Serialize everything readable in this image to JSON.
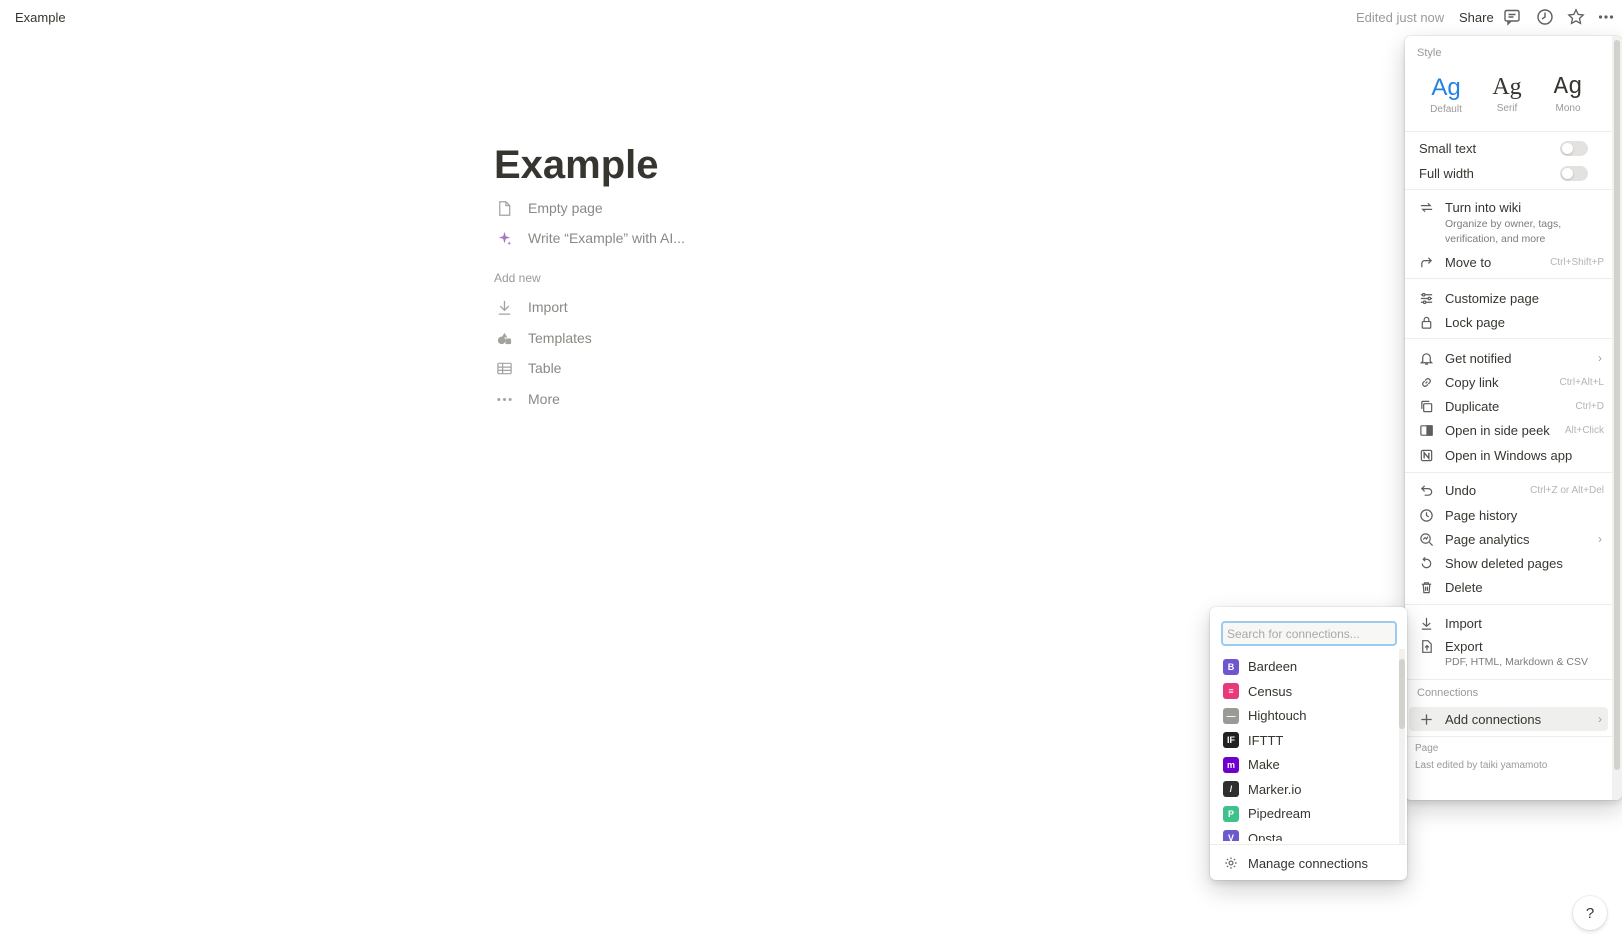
{
  "topbar": {
    "breadcrumb": "Example",
    "edited": "Edited just now",
    "share": "Share",
    "icons": [
      "comment-icon",
      "clock-icon",
      "star-icon",
      "more-icon"
    ]
  },
  "page": {
    "title": "Example",
    "options": [
      {
        "label": "Empty page",
        "icon": "page-icon"
      },
      {
        "label": "Write “Example” with AI...",
        "icon": "sparkle-icon"
      }
    ],
    "add_new_label": "Add new",
    "add_new": [
      {
        "label": "Import",
        "icon": "download-icon"
      },
      {
        "label": "Templates",
        "icon": "templates-icon"
      },
      {
        "label": "Table",
        "icon": "table-icon"
      },
      {
        "label": "More",
        "icon": "dots-icon"
      }
    ]
  },
  "menu": {
    "style_label": "Style",
    "styles": [
      {
        "sample": "Ag",
        "label": "Default",
        "active": true
      },
      {
        "sample": "Ag",
        "label": "Serif",
        "active": false
      },
      {
        "sample": "Ag",
        "label": "Mono",
        "active": false
      }
    ],
    "toggles": [
      {
        "label": "Small text",
        "on": false
      },
      {
        "label": "Full width",
        "on": false
      }
    ],
    "turn_into_wiki": {
      "label": "Turn into wiki",
      "sub": "Organize by owner, tags, verification, and more"
    },
    "move_to": {
      "label": "Move to",
      "shortcut": "Ctrl+Shift+P"
    },
    "customize": {
      "label": "Customize page"
    },
    "lock": {
      "label": "Lock page"
    },
    "get_notified": {
      "label": "Get notified"
    },
    "copy_link": {
      "label": "Copy link",
      "shortcut": "Ctrl+Alt+L"
    },
    "duplicate": {
      "label": "Duplicate",
      "shortcut": "Ctrl+D"
    },
    "side_peek": {
      "label": "Open in side peek",
      "shortcut": "Alt+Click"
    },
    "windows_app": {
      "label": "Open in Windows app"
    },
    "undo": {
      "label": "Undo",
      "shortcut": "Ctrl+Z or Alt+Del"
    },
    "page_history": {
      "label": "Page history"
    },
    "page_analytics": {
      "label": "Page analytics"
    },
    "show_deleted": {
      "label": "Show deleted pages"
    },
    "delete": {
      "label": "Delete"
    },
    "import": {
      "label": "Import"
    },
    "export": {
      "label": "Export",
      "sub": "PDF, HTML, Markdown & CSV"
    },
    "connections_label": "Connections",
    "add_connections": {
      "label": "Add connections"
    },
    "footer": {
      "line1": "Page",
      "line2": "Last edited by taiki yamamoto"
    }
  },
  "connections": {
    "search_placeholder": "Search for connections...",
    "items": [
      {
        "name": "Bardeen",
        "color": "#6e56cf",
        "glyph": "B"
      },
      {
        "name": "Census",
        "color": "#e8397a",
        "glyph": "≡"
      },
      {
        "name": "Hightouch",
        "color": "#9b9a97",
        "glyph": "—"
      },
      {
        "name": "IFTTT",
        "color": "#222222",
        "glyph": "IF"
      },
      {
        "name": "Make",
        "color": "#6d00cc",
        "glyph": "m"
      },
      {
        "name": "Marker.io",
        "color": "#2f2f2f",
        "glyph": "/"
      },
      {
        "name": "Pipedream",
        "color": "#3fc18d",
        "glyph": "P"
      },
      {
        "name": "Opsta",
        "color": "#6a5acd",
        "glyph": "V"
      }
    ],
    "manage": "Manage connections"
  },
  "help": "?"
}
